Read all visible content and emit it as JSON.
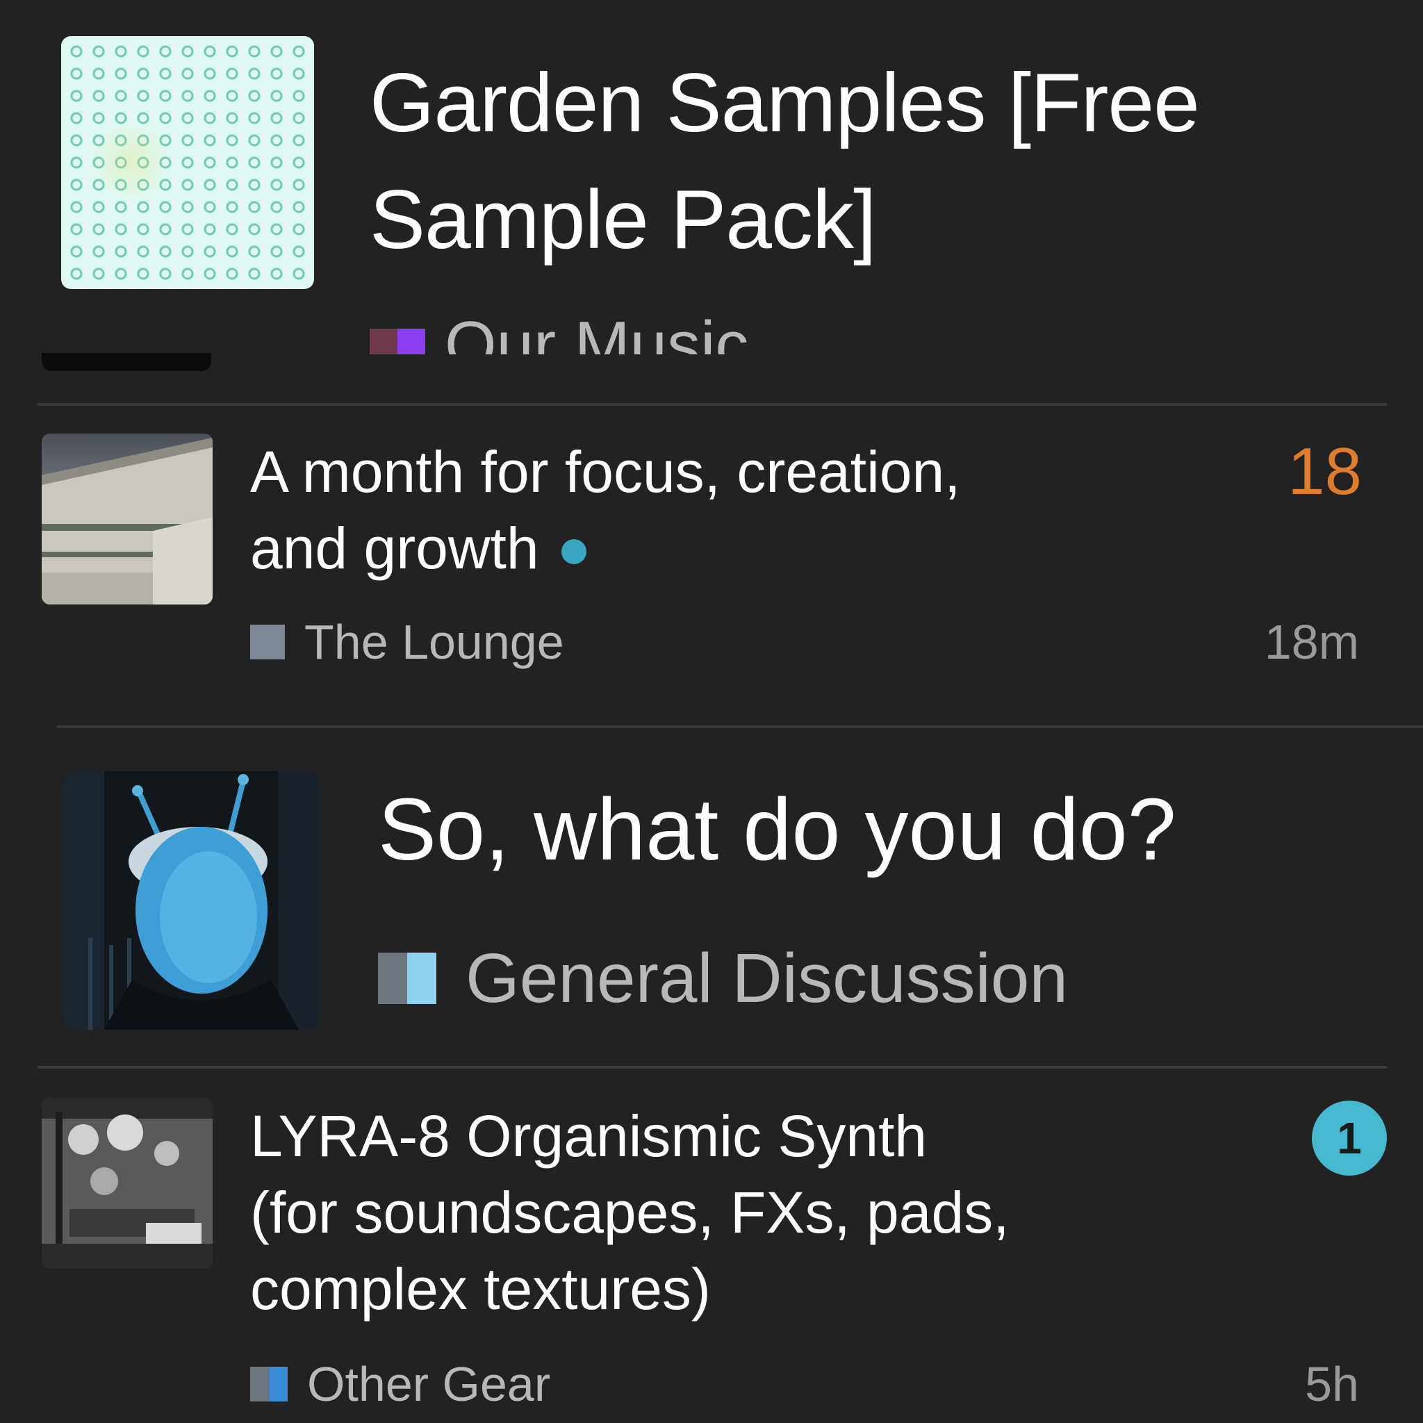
{
  "topics": [
    {
      "title_line1": "Garden Samples [Free",
      "title_line2": "Sample Pack]",
      "category": "Our Music",
      "category_colors": [
        "#6f3a4e",
        "#8b3ff0"
      ],
      "thumbnail": "garden-samples-pattern"
    },
    {
      "title_line1": "A month for focus, creation,",
      "title_line2": "and growth",
      "unread_dot_color": "#3aa6c0",
      "category": "The Lounge",
      "category_colors": [
        "#7e8794"
      ],
      "reply_count": "18",
      "reply_count_color": "#e07d2b",
      "age": "18m",
      "thumbnail": "concrete-building"
    },
    {
      "title": "So, what do you do?",
      "category": "General Discussion",
      "category_colors": [
        "#6f7680",
        "#8fd3f0"
      ],
      "thumbnail": "blue-alien-portrait"
    },
    {
      "title_line1": "LYRA-8 Organismic Synth",
      "title_line2": "(for soundscapes, FXs, pads,",
      "title_line3": "complex textures)",
      "category": "Other Gear",
      "category_colors": [
        "#6f7680",
        "#3a8ed8"
      ],
      "new_badge": "1",
      "badge_color": "#46b8cf",
      "age": "5h",
      "thumbnail": "bw-synth-photo"
    }
  ]
}
